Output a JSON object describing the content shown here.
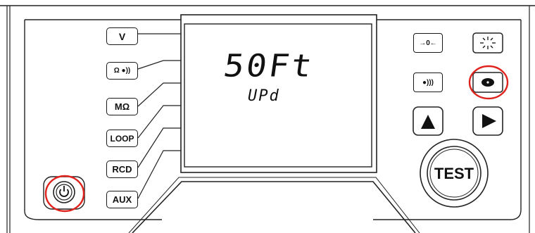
{
  "device": {
    "left_buttons": [
      "V",
      "Ω ●))",
      "MΩ",
      "LOOP",
      "RCD",
      "AUX"
    ],
    "lcd": {
      "main": "50Ft",
      "sub": "UPd"
    },
    "right_buttons": {
      "zero": "→0←",
      "buzzer": "●)))",
      "test": "TEST"
    },
    "icons": [
      "power-icon",
      "backlight-icon",
      "record-icon",
      "up-arrow-icon",
      "right-arrow-icon"
    ],
    "highlight_color": "#e0221c"
  }
}
